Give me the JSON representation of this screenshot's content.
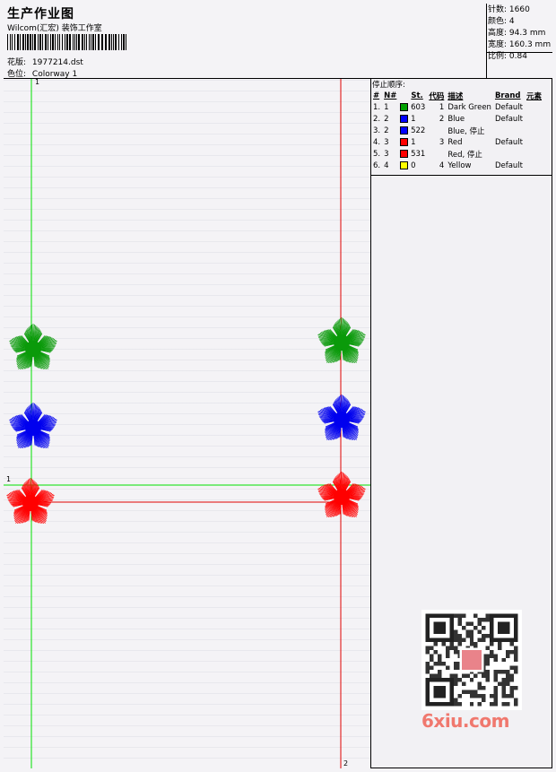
{
  "header": {
    "title": "生产作业图",
    "company": "Wilcom(汇宏) 装饰工作室",
    "pattern_label": "花版:",
    "pattern_value": "1977214.dst",
    "colorway_label": "色位:",
    "colorway_value": "Colorway 1"
  },
  "stats": {
    "stitches_label": "针数:",
    "stitches_value": "1660",
    "colors_label": "颜色:",
    "colors_value": "4",
    "height_label": "高度:",
    "height_value": "94.3 mm",
    "width_label": "宽度:",
    "width_value": "160.3 mm",
    "ratio_label": "比例:",
    "ratio_value": "0.84"
  },
  "stop_sequence": {
    "title": "停止顺序:",
    "columns": [
      "#",
      "N#",
      "St.",
      "代码",
      "描述",
      "Brand",
      "元素"
    ],
    "rows": [
      {
        "idx": "1.",
        "n": "1",
        "color": "#00a000",
        "st": "603",
        "code": "1",
        "desc": "Dark Green",
        "brand": "Default"
      },
      {
        "idx": "2.",
        "n": "2",
        "color": "#0000ff",
        "st": "1",
        "code": "2",
        "desc": "Blue",
        "brand": "Default"
      },
      {
        "idx": "3.",
        "n": "2",
        "color": "#0000ff",
        "st": "522",
        "code": "",
        "desc": "Blue, 停止",
        "brand": ""
      },
      {
        "idx": "4.",
        "n": "3",
        "color": "#ff0000",
        "st": "1",
        "code": "3",
        "desc": "Red",
        "brand": "Default"
      },
      {
        "idx": "5.",
        "n": "3",
        "color": "#ff0000",
        "st": "531",
        "code": "",
        "desc": "Red, 停止",
        "brand": ""
      },
      {
        "idx": "6.",
        "n": "4",
        "color": "#ffff00",
        "st": "0",
        "code": "4",
        "desc": "Yellow",
        "brand": "Default"
      }
    ]
  },
  "guides": {
    "green_label": "1",
    "red_label": "2",
    "green_h_label": "1",
    "green_color": "#00e000",
    "red_color": "#e00000"
  },
  "flower_colors": {
    "green": "#0a9a0a",
    "blue": "#0000ee",
    "red": "#ff0000"
  },
  "watermark": {
    "text": "6xiu.com"
  }
}
